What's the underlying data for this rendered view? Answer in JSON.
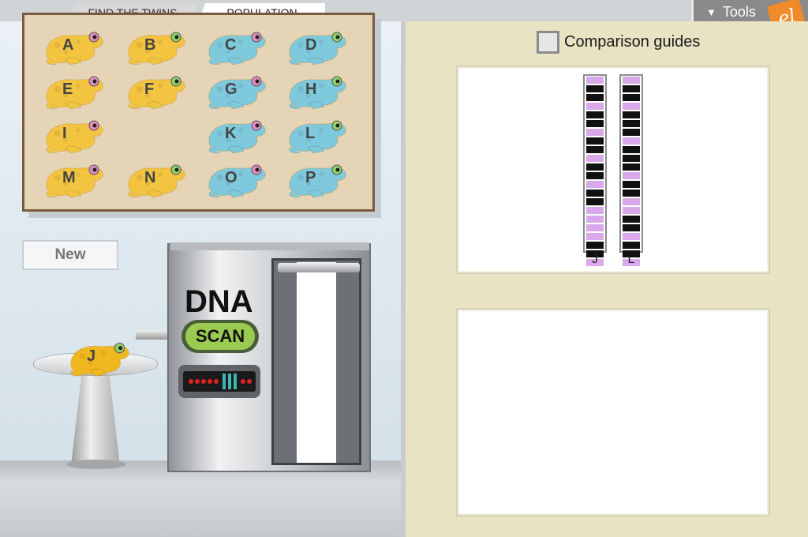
{
  "tabs": [
    {
      "label": "FIND THE TWINS",
      "active": false
    },
    {
      "label": "POPULATION",
      "active": true
    }
  ],
  "tools": {
    "label": "Tools",
    "logo": "el"
  },
  "board": {
    "frogs": [
      {
        "letter": "A",
        "color": "yellow"
      },
      {
        "letter": "B",
        "color": "yellow"
      },
      {
        "letter": "C",
        "color": "blue"
      },
      {
        "letter": "D",
        "color": "blue"
      },
      {
        "letter": "E",
        "color": "yellow"
      },
      {
        "letter": "F",
        "color": "yellow"
      },
      {
        "letter": "G",
        "color": "blue"
      },
      {
        "letter": "H",
        "color": "blue"
      },
      {
        "letter": "I",
        "color": "yellow"
      },
      {
        "letter": "",
        "color": "none"
      },
      {
        "letter": "K",
        "color": "blue"
      },
      {
        "letter": "L",
        "color": "blue"
      },
      {
        "letter": "M",
        "color": "yellow"
      },
      {
        "letter": "N",
        "color": "yellow"
      },
      {
        "letter": "O",
        "color": "blue"
      },
      {
        "letter": "P",
        "color": "blue"
      }
    ]
  },
  "new_button": "New",
  "scanner": {
    "title": "DNA",
    "scan_label": "SCAN"
  },
  "stand_frog": {
    "letter": "J"
  },
  "comparison": {
    "label": "Comparison guides",
    "checked": false
  },
  "strands": [
    {
      "label": "J",
      "pattern": [
        0,
        1,
        1,
        0,
        1,
        1,
        0,
        1,
        1,
        0,
        1,
        1,
        0,
        1,
        1,
        0,
        0,
        0,
        0,
        1,
        1,
        0
      ]
    },
    {
      "label": "L",
      "pattern": [
        0,
        1,
        1,
        0,
        1,
        1,
        1,
        0,
        1,
        1,
        1,
        0,
        1,
        1,
        0,
        0,
        1,
        1,
        0,
        1,
        1,
        0
      ]
    }
  ],
  "colors": {
    "purple_seg": "#d9a8ea",
    "black_seg": "#111111",
    "right_bg": "#e8e4c3",
    "yellow_frog": "#f2c440",
    "blue_frog": "#7ec9dc"
  }
}
